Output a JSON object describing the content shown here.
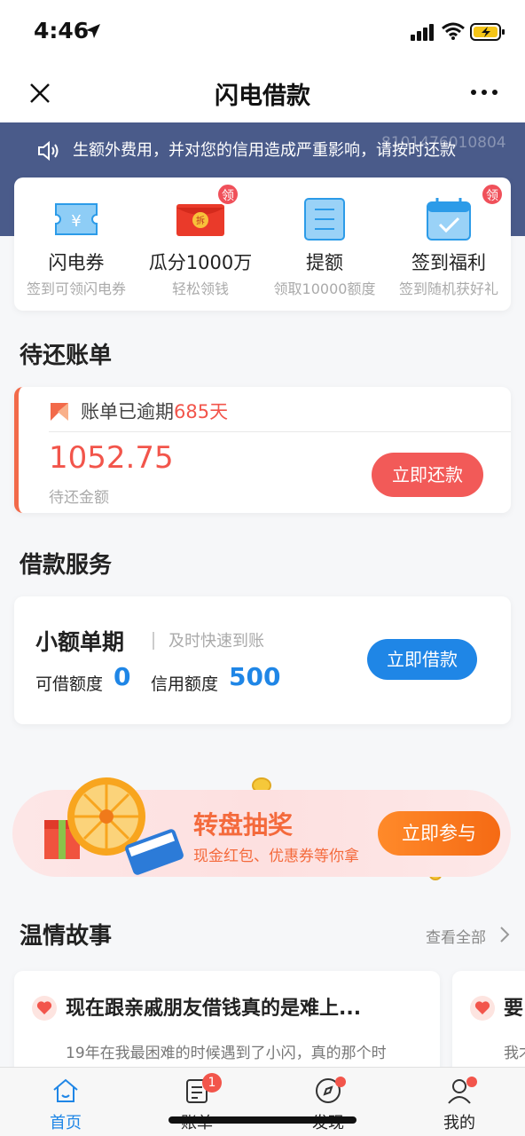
{
  "status_bar": {
    "time": "4:46"
  },
  "nav": {
    "title": "闪电借款"
  },
  "notice": {
    "text": "生额外费用，并对您的信用造成严重影响，请按时还款",
    "ghost_number": "8101476010804"
  },
  "quick_actions": [
    {
      "title": "闪电券",
      "subtitle": "签到可领闪电券",
      "badge": ""
    },
    {
      "title": "瓜分1000万",
      "subtitle": "轻松领钱",
      "badge": "领"
    },
    {
      "title": "提额",
      "subtitle": "领取10000额度",
      "badge": ""
    },
    {
      "title": "签到福利",
      "subtitle": "签到随机获好礼",
      "badge": "领"
    }
  ],
  "bills": {
    "section_title": "待还账单",
    "status_prefix": "账单已逾期",
    "overdue_days": "685天",
    "amount": "1052.75",
    "amount_label": "待还金额",
    "repay_button": "立即还款"
  },
  "loan_service": {
    "section_title": "借款服务",
    "product_name": "小额单期",
    "product_tag": "及时快速到账",
    "available_label": "可借额度",
    "available_value": "0",
    "credit_label": "信用额度",
    "credit_value": "500",
    "borrow_button": "立即借款"
  },
  "promo": {
    "title": "转盘抽奖",
    "subtitle": "现金红包、优惠券等你拿",
    "button": "立即参与"
  },
  "stories": {
    "section_title": "温情故事",
    "view_all": "查看全部",
    "items": [
      {
        "title": "现在跟亲戚朋友借钱真的是难上...",
        "text": "19年在我最困难的时候遇到了小闪，真的那个时"
      },
      {
        "title": "要",
        "text": "我才"
      }
    ]
  },
  "tab_bar": {
    "items": [
      {
        "label": "首页"
      },
      {
        "label": "账单",
        "badge": "1"
      },
      {
        "label": "发现"
      },
      {
        "label": "我的"
      }
    ]
  },
  "colors": {
    "primary_blue": "#1f86e6",
    "alert_red": "#f2554b",
    "banner_navy": "#4a5b8a",
    "promo_orange": "#f56a14"
  }
}
